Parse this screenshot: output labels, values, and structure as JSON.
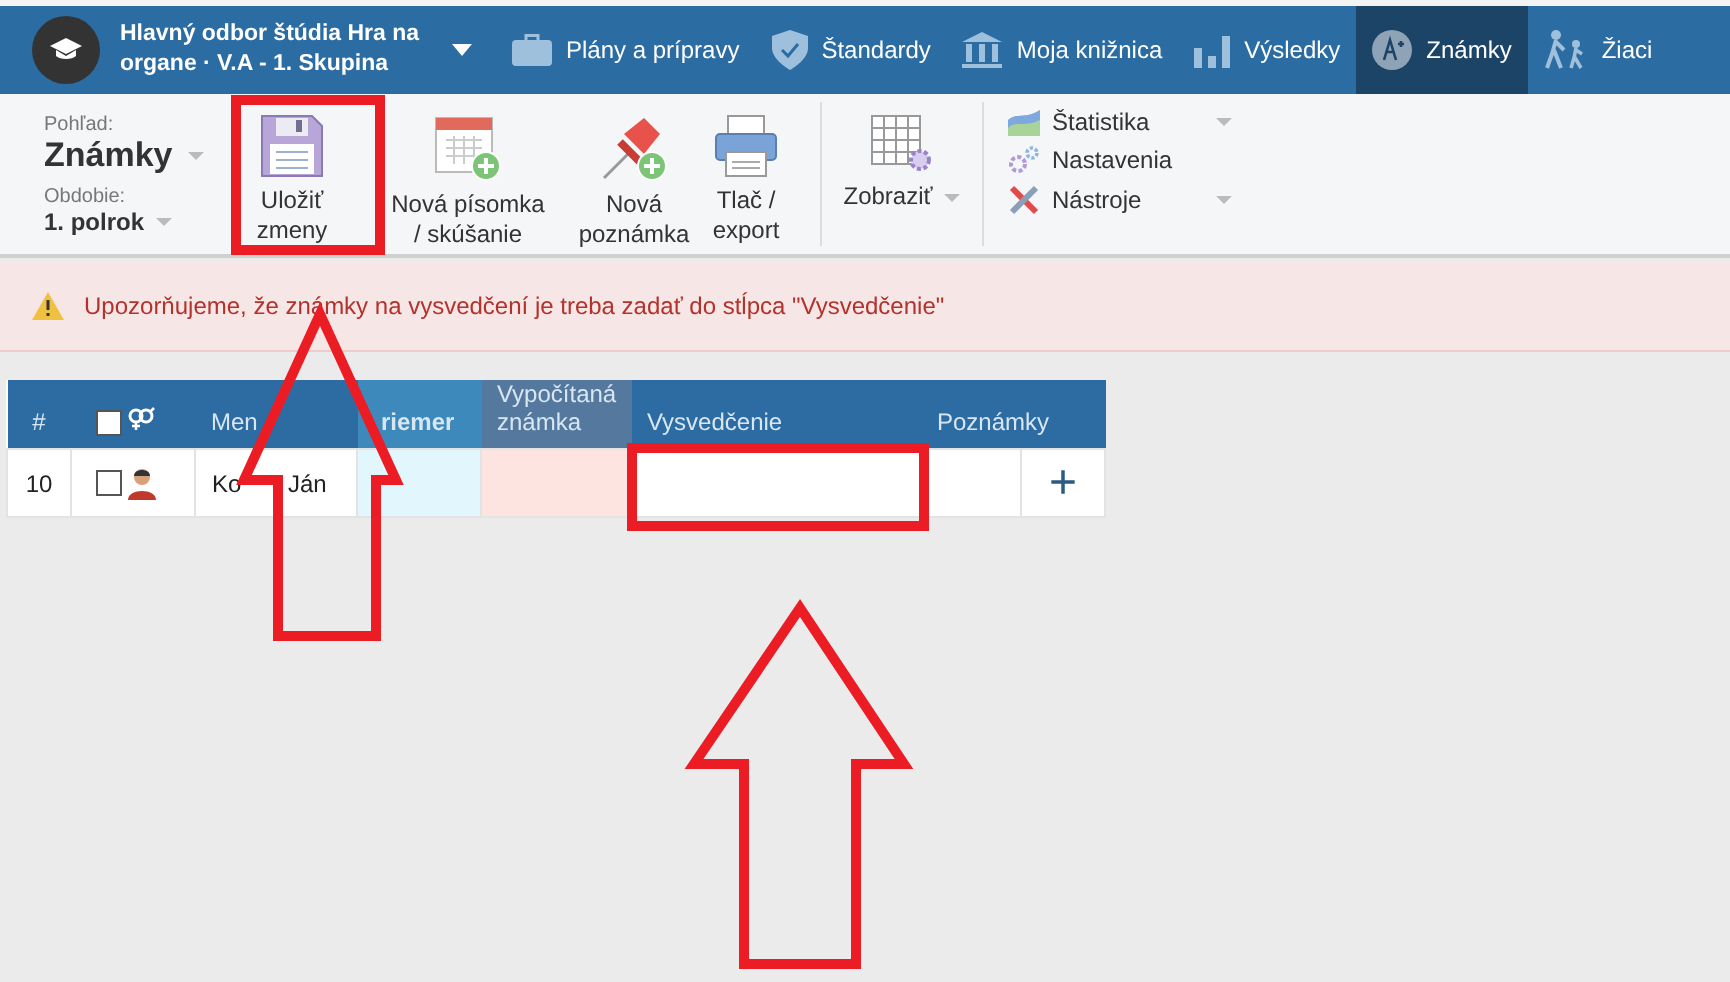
{
  "header": {
    "title": "Hlavný odbor štúdia Hra na organe · V.A - 1. Skupina"
  },
  "nav": [
    {
      "label": "Plány a prípravy",
      "selected": false
    },
    {
      "label": "Štandardy",
      "selected": false
    },
    {
      "label": "Moja knižnica",
      "selected": false
    },
    {
      "label": "Výsledky",
      "selected": false
    },
    {
      "label": "Známky",
      "selected": true
    },
    {
      "label": "Žiaci",
      "selected": false
    }
  ],
  "toolbar": {
    "view_label": "Pohľad:",
    "view_value": "Známky",
    "period_label": "Obdobie:",
    "period_value": "1. polrok",
    "buttons": [
      {
        "label": "Uložiť zmeny"
      },
      {
        "label": "Nová písomka / skúšanie"
      },
      {
        "label": "Nová poznámka"
      },
      {
        "label": "Tlač / export"
      }
    ],
    "display": {
      "label": "Zobraziť"
    },
    "menu": [
      {
        "label": "Štatistika",
        "dropdown": true
      },
      {
        "label": "Nastavenia",
        "dropdown": false
      },
      {
        "label": "Nástroje",
        "dropdown": true
      }
    ]
  },
  "warning": "Upozorňujeme, že známky na vysvedčení je treba zadať do stĺpca \"Vysvedčenie\"",
  "table": {
    "all_selected": false,
    "columns": [
      "#",
      "Men",
      "riemer",
      "Vypočítaná známka",
      "Vysvedčenie",
      "Poznámky"
    ],
    "rows": [
      {
        "number": "10",
        "checked": false,
        "name": "Ko Ján",
        "add": "+"
      }
    ]
  }
}
